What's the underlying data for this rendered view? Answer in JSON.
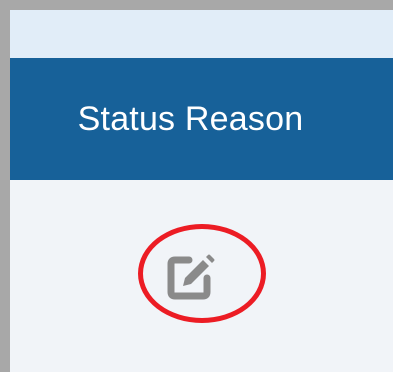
{
  "table": {
    "column_header": "Status Reason",
    "row_action": {
      "icon": "edit-icon",
      "icon_color": "#8a8a8a",
      "highlight_color": "#ec1c24"
    }
  },
  "colors": {
    "header_background": "#176199",
    "top_strip": "#e1edf8",
    "cell_background": "#f1f4f8",
    "border": "#a8a8a8"
  }
}
